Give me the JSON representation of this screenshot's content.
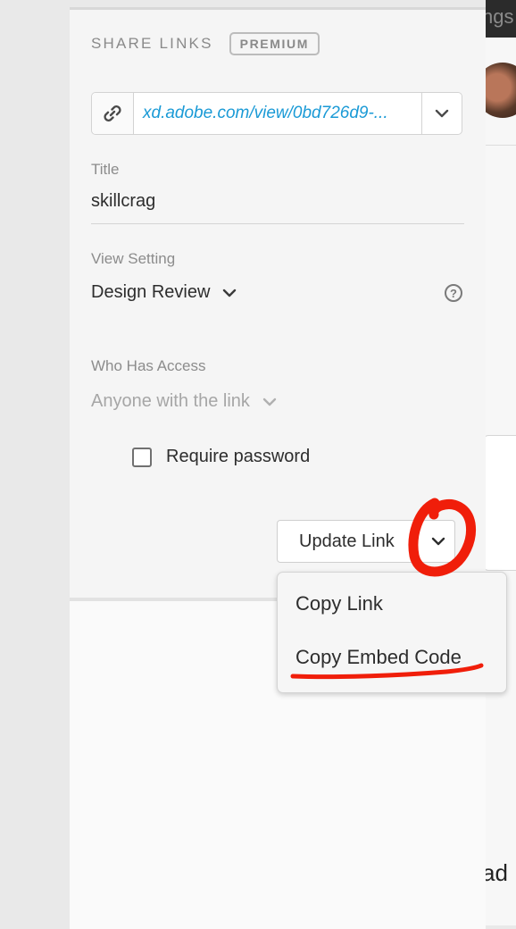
{
  "background": {
    "topbar_text": "ngs",
    "bottom_text": "ad"
  },
  "share_panel": {
    "title": "SHARE LINKS",
    "badge": "PREMIUM",
    "link": {
      "url": "xd.adobe.com/view/0bd726d9-...",
      "icon": "link-icon"
    },
    "title_label": "Title",
    "title_value": "skillcrag",
    "view_setting_label": "View Setting",
    "view_setting_value": "Design Review",
    "help_glyph": "?",
    "access_label": "Who Has Access",
    "access_value": "Anyone with the link",
    "require_password_label": "Require password",
    "require_password_checked": false,
    "update_button_label": "Update Link"
  },
  "dropdown_menu": {
    "items": [
      {
        "label": "Copy Link"
      },
      {
        "label": "Copy Embed Code"
      }
    ]
  },
  "colors": {
    "link_blue": "#1a9ad6",
    "annotation_red": "#f01e0a"
  }
}
